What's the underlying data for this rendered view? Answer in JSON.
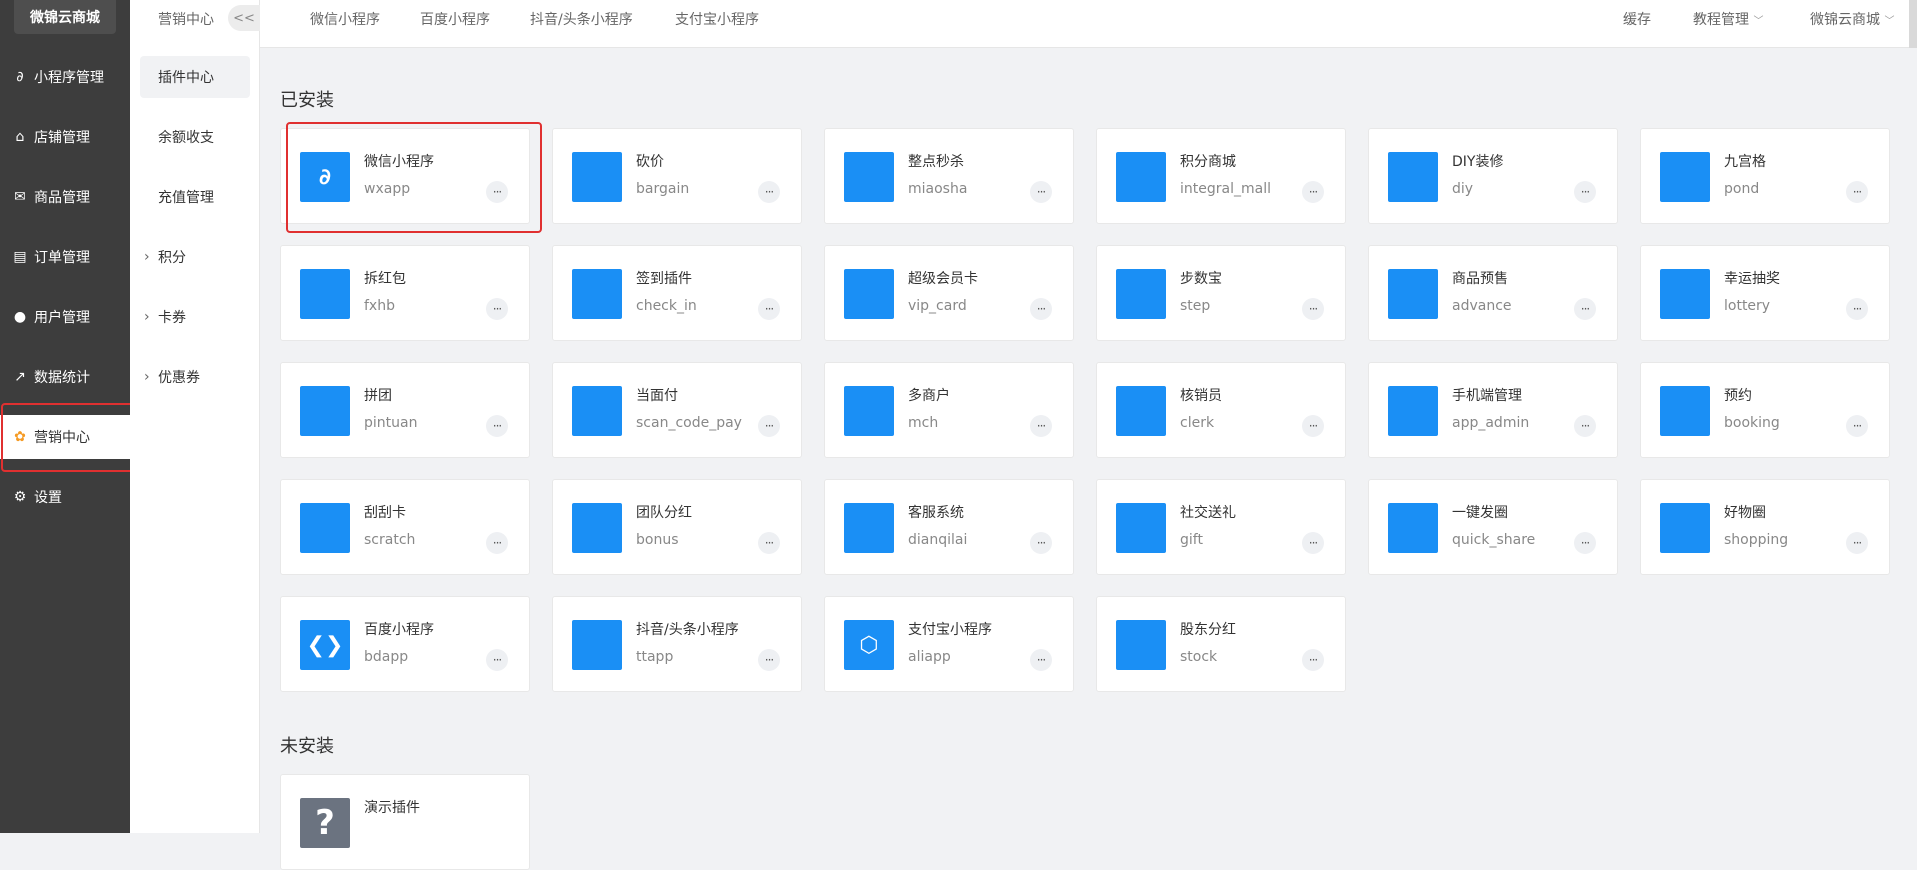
{
  "brand": "微锦云商城",
  "sidebar": {
    "items": [
      {
        "label": "小程序管理",
        "icon": "mini-program-icon"
      },
      {
        "label": "店铺管理",
        "icon": "store-icon"
      },
      {
        "label": "商品管理",
        "icon": "goods-icon"
      },
      {
        "label": "订单管理",
        "icon": "order-icon"
      },
      {
        "label": "用户管理",
        "icon": "user-icon"
      },
      {
        "label": "数据统计",
        "icon": "stats-icon"
      },
      {
        "label": "营销中心",
        "icon": "marketing-icon"
      },
      {
        "label": "设置",
        "icon": "settings-icon"
      }
    ]
  },
  "subnav": {
    "title": "营销中心",
    "collapse": "<<",
    "items": [
      {
        "label": "插件中心"
      },
      {
        "label": "余额收支"
      },
      {
        "label": "充值管理"
      },
      {
        "label": "积分"
      },
      {
        "label": "卡券"
      },
      {
        "label": "优惠券"
      }
    ]
  },
  "topbar": {
    "tabs": [
      "微信小程序",
      "百度小程序",
      "抖音/头条小程序",
      "支付宝小程序"
    ],
    "cache": "缓存",
    "tutorial": "教程管理",
    "account": "微锦云商城"
  },
  "installed": {
    "title": "已安装",
    "plugins": [
      {
        "name": "微信小程序",
        "key": "wxapp",
        "icon": "wechat-mini-icon"
      },
      {
        "name": "砍价",
        "key": "bargain",
        "icon": "bargain-icon"
      },
      {
        "name": "整点秒杀",
        "key": "miaosha",
        "icon": "flash-sale-icon"
      },
      {
        "name": "积分商城",
        "key": "integral_mall",
        "icon": "integral-mall-icon"
      },
      {
        "name": "DIY装修",
        "key": "diy",
        "icon": "diy-icon"
      },
      {
        "name": "九宫格",
        "key": "pond",
        "icon": "grid-icon"
      },
      {
        "name": "拆红包",
        "key": "fxhb",
        "icon": "red-packet-icon"
      },
      {
        "name": "签到插件",
        "key": "check_in",
        "icon": "check-in-icon"
      },
      {
        "name": "超级会员卡",
        "key": "vip_card",
        "icon": "vip-card-icon"
      },
      {
        "name": "步数宝",
        "key": "step",
        "icon": "step-icon"
      },
      {
        "name": "商品预售",
        "key": "advance",
        "icon": "presale-icon"
      },
      {
        "name": "幸运抽奖",
        "key": "lottery",
        "icon": "lottery-icon"
      },
      {
        "name": "拼团",
        "key": "pintuan",
        "icon": "group-buy-icon"
      },
      {
        "name": "当面付",
        "key": "scan_code_pay",
        "icon": "scan-pay-icon"
      },
      {
        "name": "多商户",
        "key": "mch",
        "icon": "multi-merchant-icon"
      },
      {
        "name": "核销员",
        "key": "clerk",
        "icon": "clerk-icon"
      },
      {
        "name": "手机端管理",
        "key": "app_admin",
        "icon": "mobile-admin-icon"
      },
      {
        "name": "预约",
        "key": "booking",
        "icon": "booking-icon"
      },
      {
        "name": "刮刮卡",
        "key": "scratch",
        "icon": "scratch-card-icon"
      },
      {
        "name": "团队分红",
        "key": "bonus",
        "icon": "team-bonus-icon"
      },
      {
        "name": "客服系统",
        "key": "dianqilai",
        "icon": "customer-service-icon"
      },
      {
        "name": "社交送礼",
        "key": "gift",
        "icon": "gift-icon"
      },
      {
        "name": "一键发圈",
        "key": "quick_share",
        "icon": "quick-share-icon"
      },
      {
        "name": "好物圈",
        "key": "shopping",
        "icon": "shopping-circle-icon"
      },
      {
        "name": "百度小程序",
        "key": "bdapp",
        "icon": "baidu-mini-icon"
      },
      {
        "name": "抖音/头条小程序",
        "key": "ttapp",
        "icon": "tiktok-mini-icon"
      },
      {
        "name": "支付宝小程序",
        "key": "aliapp",
        "icon": "alipay-mini-icon"
      },
      {
        "name": "股东分红",
        "key": "stock",
        "icon": "stock-bonus-icon"
      }
    ]
  },
  "uninstalled": {
    "title": "未安装",
    "plugins": [
      {
        "name": "演示插件",
        "key": "",
        "icon": "question-icon"
      }
    ]
  },
  "more_label": "···"
}
